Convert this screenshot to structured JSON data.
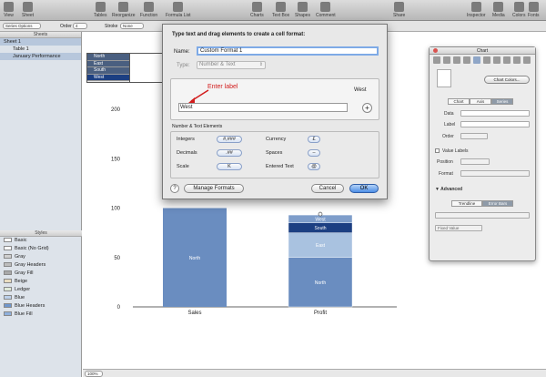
{
  "toolbar": {
    "items": [
      {
        "label": "View",
        "icon": "view-icon"
      },
      {
        "label": "Sheet",
        "icon": "sheet-icon"
      },
      {
        "label": "Tables",
        "icon": "tables-icon"
      },
      {
        "label": "Reorganize",
        "icon": "reorganize-icon"
      },
      {
        "label": "Function",
        "icon": "function-icon"
      },
      {
        "label": "Formula List",
        "icon": "formula-list-icon"
      },
      {
        "label": "Charts",
        "icon": "charts-icon"
      },
      {
        "label": "Text Box",
        "icon": "text-box-icon"
      },
      {
        "label": "Shapes",
        "icon": "shapes-icon"
      },
      {
        "label": "Comment",
        "icon": "comment-icon"
      },
      {
        "label": "Share",
        "icon": "share-icon"
      },
      {
        "label": "Inspector",
        "icon": "inspector-icon"
      },
      {
        "label": "Media",
        "icon": "media-icon"
      },
      {
        "label": "Colors",
        "icon": "colors-icon"
      },
      {
        "label": "Fonts",
        "icon": "fonts-icon"
      }
    ]
  },
  "format_bar": {
    "series_options": "Series Options",
    "order_label": "Order",
    "order_value": "4",
    "stroke_label": "Stroke",
    "stroke_value": "None"
  },
  "sidebar": {
    "sheets_header": "Sheets",
    "sheets": [
      {
        "label": "Sheet 1"
      },
      {
        "label": "Table 1"
      },
      {
        "label": "January Performance"
      }
    ],
    "styles_header": "Styles",
    "styles": [
      {
        "label": "Basic",
        "color": "#ffffff"
      },
      {
        "label": "Basic (No Grid)",
        "color": "#ffffff"
      },
      {
        "label": "Gray",
        "color": "#d0d0d0"
      },
      {
        "label": "Gray Headers",
        "color": "#bdbdbd"
      },
      {
        "label": "Gray Fill",
        "color": "#a8a8a8"
      },
      {
        "label": "Beige",
        "color": "#e8dcc0"
      },
      {
        "label": "Ledger",
        "color": "#dfe9d8"
      },
      {
        "label": "Blue",
        "color": "#bcd0ea"
      },
      {
        "label": "Blue Headers",
        "color": "#6f96cc"
      },
      {
        "label": "Blue Fill",
        "color": "#8fb0dc"
      }
    ]
  },
  "table_rows": [
    "North",
    "East",
    "South",
    "West"
  ],
  "chart_data": {
    "type": "bar",
    "stacked": true,
    "categories": [
      "Sales",
      "Profit"
    ],
    "series": [
      {
        "name": "North",
        "values": [
          null,
          50
        ],
        "color": "#6a8dc0"
      },
      {
        "name": "East",
        "values": [
          null,
          25
        ],
        "color": "#a9c2e0"
      },
      {
        "name": "South",
        "values": [
          null,
          10
        ],
        "color": "#1c3f82"
      },
      {
        "name": "West",
        "values": [
          null,
          8
        ],
        "color": "#7e9dca"
      }
    ],
    "visible_segment_labels": [
      {
        "category": "Sales",
        "series": "North",
        "value": 100
      }
    ],
    "ytick_labels": [
      "0",
      "50",
      "100",
      "150",
      "200"
    ],
    "ylim": [
      0,
      200
    ],
    "grid": false
  },
  "dialog": {
    "title": "Type text and drag elements to create a cell format:",
    "name_label": "Name:",
    "name_value": "Custom Format 1",
    "type_label": "Type:",
    "type_value": "Number & Text",
    "preview_label": "West",
    "annotation": "Enter label",
    "format_field_value": "West",
    "elements_header": "Number & Text Elements",
    "elements": [
      {
        "label": "Integers",
        "token": "#,###"
      },
      {
        "label": "Currency",
        "token": "£"
      },
      {
        "label": "Decimals",
        "token": ".##"
      },
      {
        "label": "Spaces",
        "token": "–"
      },
      {
        "label": "Scale",
        "token": "K"
      },
      {
        "label": "Entered Text",
        "token": "@"
      }
    ],
    "help_label": "?",
    "manage_label": "Manage Formats",
    "cancel_label": "Cancel",
    "ok_label": "OK"
  },
  "inspector": {
    "title": "Chart",
    "chart_colors_button": "Chart Colors...",
    "tabs": [
      "Chart",
      "Axis",
      "Series"
    ],
    "active_tab": "Series",
    "data_label": "Data",
    "label_label": "Label",
    "order_label": "Order",
    "value_labels": "Value Labels",
    "position_label": "Position",
    "format_label": "Format",
    "advanced_label": "Advanced",
    "sub_tabs": [
      "Trendline",
      "Error Bars"
    ],
    "fixed_value": "Fixed Value"
  },
  "status": {
    "zoom": "100%"
  },
  "colors": {
    "accent": "#4d8ee6",
    "annotation": "#d21d1d"
  }
}
